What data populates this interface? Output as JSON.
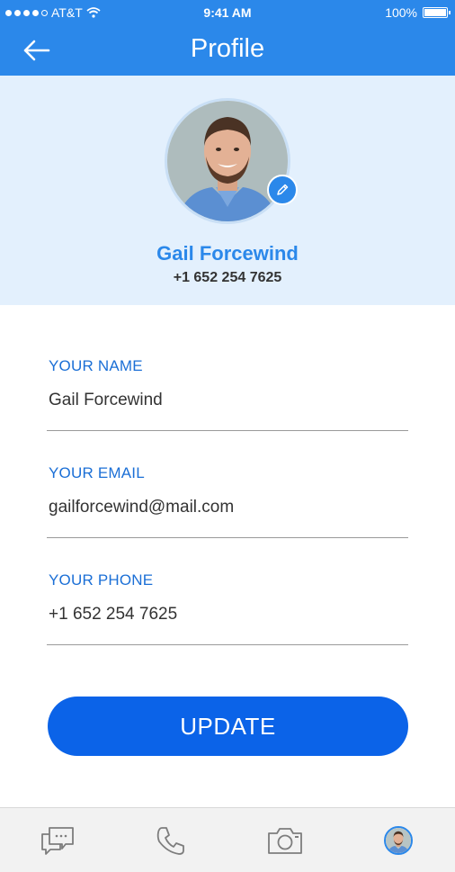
{
  "status_bar": {
    "carrier": "AT&T",
    "time": "9:41 AM",
    "battery": "100%"
  },
  "nav": {
    "title": "Profile",
    "back_icon": "arrow-left-icon"
  },
  "profile": {
    "name": "Gail Forcewind",
    "phone": "+1 652 254 7625",
    "edit_icon": "pencil-icon"
  },
  "form": {
    "name_label": "YOUR NAME",
    "name_value": "Gail Forcewind",
    "email_label": "YOUR EMAIL",
    "email_value": "gailforcewind@mail.com",
    "phone_label": "YOUR PHONE",
    "phone_value": "+1 652 254 7625"
  },
  "update_button": {
    "label": "UPDATE"
  },
  "tab_bar": {
    "items": [
      {
        "icon": "chat-icon"
      },
      {
        "icon": "phone-icon"
      },
      {
        "icon": "camera-icon"
      },
      {
        "icon": "profile-avatar"
      }
    ]
  },
  "colors": {
    "primary": "#2b88ea",
    "button": "#0b63e8",
    "label": "#1b6fd6",
    "header_bg": "#e3f0fd"
  }
}
